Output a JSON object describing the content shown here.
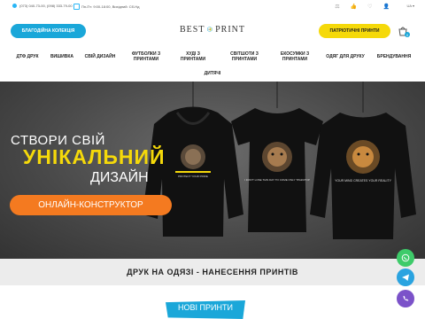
{
  "topbar": {
    "phones": "(073) 040-73-00, (098) 333-79-00",
    "hours": "Пн-Пт: 9:00-18:00, Вихідний: Сб-Нд",
    "language": "UA"
  },
  "logo": {
    "left": "BEST",
    "monogram": "BP",
    "right": "PRINT"
  },
  "header": {
    "charity_button": "БЛАГОДІЙНА КОЛЕКЦІЯ",
    "patriotic_button": "ПАТРІОТИЧНІ ПРИНТИ",
    "cart_count": "0"
  },
  "nav": {
    "items": [
      "ДТФ ДРУК",
      "ВИШИВКА",
      "СВІЙ ДИЗАЙН",
      "ФУТБОЛКИ З ПРИНТАМИ",
      "ХУДІ З ПРИНТАМИ",
      "СВІТШОТИ З ПРИНТАМИ",
      "ЕКОСУМКИ З ПРИНТАМИ",
      "ОДЯГ ДЛЯ ДРУКУ",
      "БРЕНДУВАННЯ",
      "ДИТЯЧІ"
    ]
  },
  "hero": {
    "line1": "СТВОРИ СВІЙ",
    "line2": "УНІКАЛЬНИЙ",
    "line3": "ДИЗАЙН",
    "cta": "ОНЛАЙН-КОНСТРУКТОР",
    "shirt1_text": "PROTECT YOUR PRIDE",
    "shirt2_text": "I DON'T LOSE THIS DAY TO COME ONLY ТРАЄКТОР",
    "shirt3_text": "YOUR MIND CREATES YOUR REALITY"
  },
  "section": {
    "title": "ДРУК НА ОДЯЗІ - НАНЕСЕННЯ ПРИНТІВ"
  },
  "new_prints": {
    "label": "НОВІ ПРИНТИ"
  },
  "colors": {
    "accent_blue": "#1aa7d9",
    "accent_yellow": "#f5d90a",
    "accent_orange": "#f47a20",
    "whatsapp": "#3ecb6a",
    "telegram": "#2aa3e0",
    "viber": "#7b52c9"
  },
  "icons": [
    "phone-icon",
    "clock-icon",
    "scales-icon",
    "thumbs-up-icon",
    "heart-icon",
    "user-icon",
    "cart-icon",
    "whatsapp-icon",
    "telegram-icon",
    "viber-icon"
  ]
}
